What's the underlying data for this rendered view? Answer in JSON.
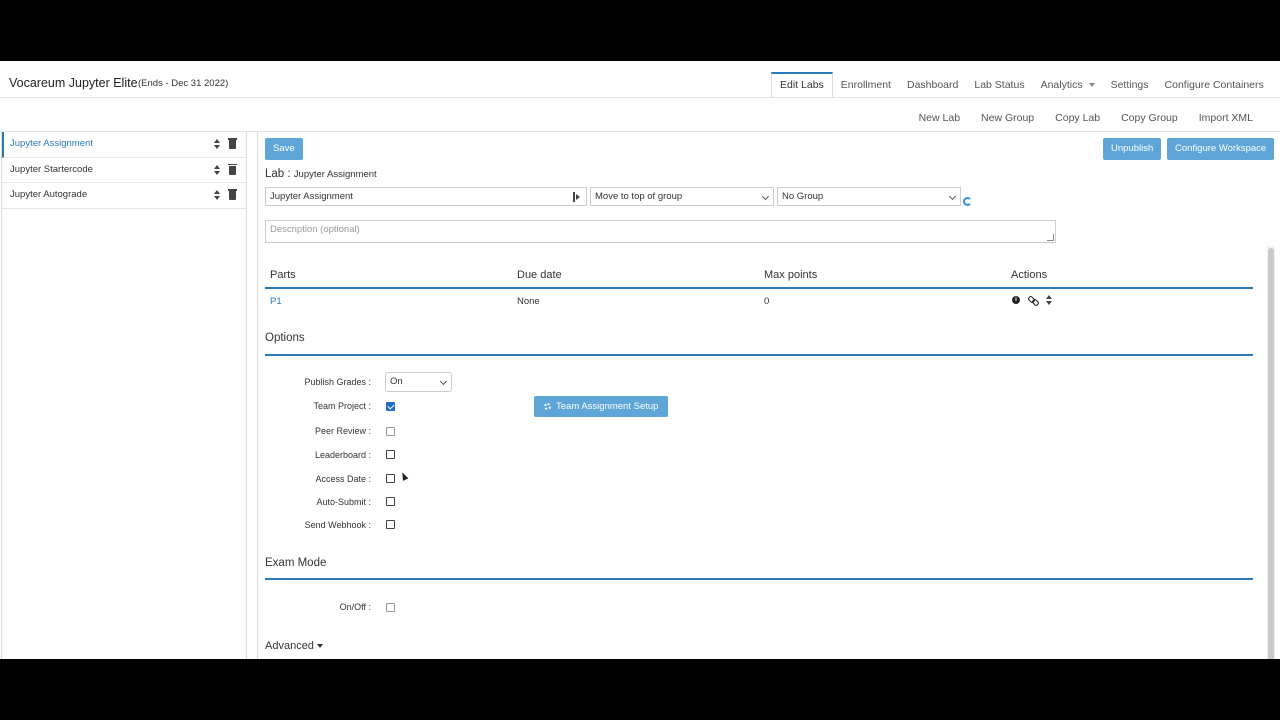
{
  "header": {
    "app_title": "Vocareum Jupyter Elite",
    "ends": "(Ends - Dec 31 2022)"
  },
  "topnav": {
    "tabs": [
      {
        "label": "Edit Labs",
        "active": true
      },
      {
        "label": "Enrollment"
      },
      {
        "label": "Dashboard"
      },
      {
        "label": "Lab Status"
      },
      {
        "label": "Analytics"
      },
      {
        "label": "Settings"
      },
      {
        "label": "Configure Containers"
      }
    ]
  },
  "subnav": {
    "links": [
      "New Lab",
      "New Group",
      "Copy Lab",
      "Copy Group",
      "Import XML"
    ]
  },
  "sidebar": {
    "items": [
      {
        "label": "Jupyter Assignment",
        "active": true
      },
      {
        "label": "Jupyter Startercode"
      },
      {
        "label": "Jupyter Autograde"
      }
    ]
  },
  "toolbar": {
    "save": "Save",
    "unpublish": "Unpublish",
    "configure_workspace": "Configure Workspace"
  },
  "lab": {
    "label": "Lab :",
    "name": "Jupyter Assignment",
    "name_value": "Jupyter Assignment",
    "position_select": "Move to top of group",
    "group_select": "No Group",
    "description_placeholder": "Description (optional)"
  },
  "parts_table": {
    "headers": [
      "Parts",
      "Due date",
      "Max points",
      "Actions"
    ],
    "rows": [
      {
        "part": "P1",
        "due": "None",
        "max_points": "0"
      }
    ]
  },
  "options": {
    "title": "Options",
    "publish_grades_label": "Publish Grades :",
    "publish_grades_value": "On",
    "team_project_label": "Team Project :",
    "team_project_checked": true,
    "team_setup_button": "Team Assignment Setup",
    "peer_review_label": "Peer Review :",
    "leaderboard_label": "Leaderboard :",
    "access_date_label": "Access Date :",
    "auto_submit_label": "Auto-Submit :",
    "send_webhook_label": "Send Webhook :"
  },
  "exam_mode": {
    "title": "Exam Mode",
    "onoff_label": "On/Off :"
  },
  "advanced": {
    "label": "Advanced"
  },
  "colors": {
    "accent": "#2a7ab9",
    "button": "#5ea6d8",
    "checkbox_checked": "#1f6fd1"
  }
}
